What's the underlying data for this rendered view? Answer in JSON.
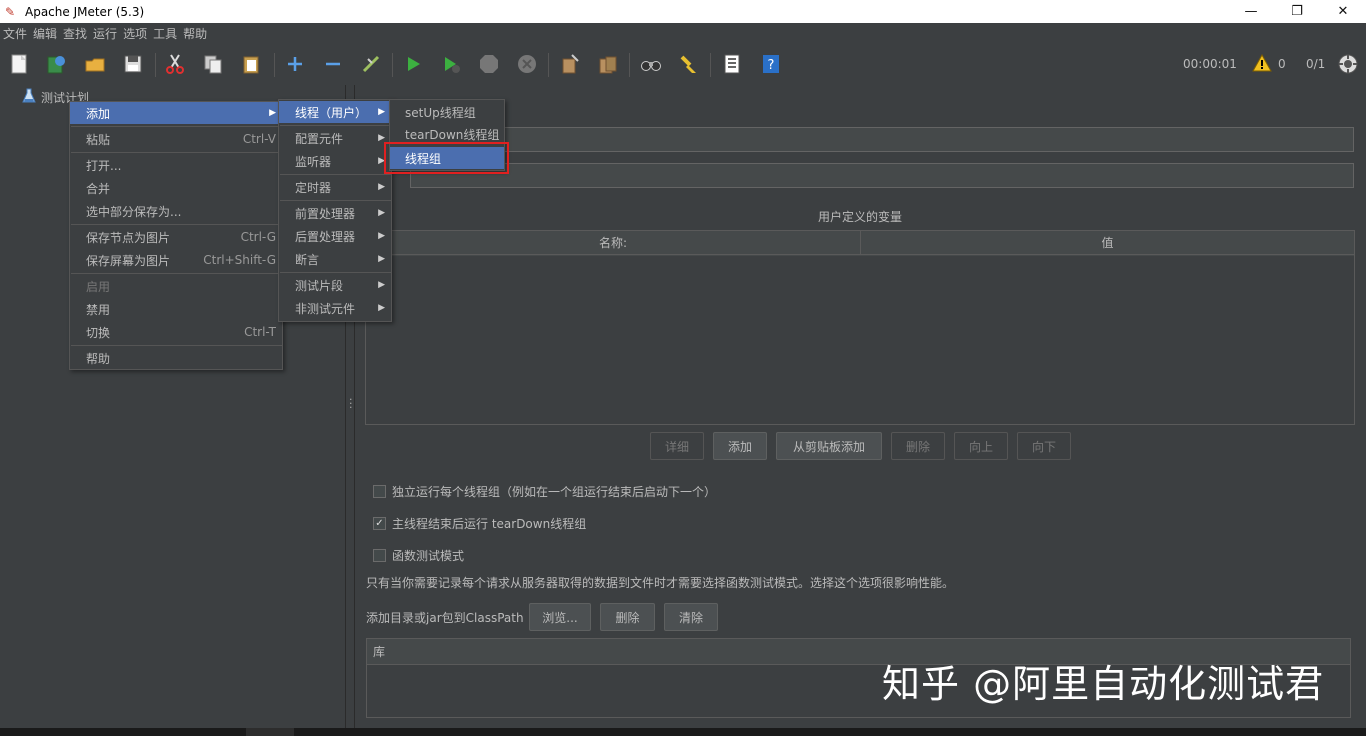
{
  "window": {
    "title": "Apache JMeter (5.3)",
    "controls": {
      "minimize": "—",
      "restore": "❐",
      "close": "✕"
    }
  },
  "menubar": [
    "文件",
    "编辑",
    "查找",
    "运行",
    "选项",
    "工具",
    "帮助"
  ],
  "toolbar": {
    "buttons": [
      "new-icon",
      "templates-icon",
      "open-icon",
      "save-icon",
      "cut-icon",
      "copy-icon",
      "paste-icon",
      "expand-icon",
      "collapse-icon",
      "toggle-icon",
      "start-icon",
      "start-no-pause-icon",
      "stop-icon",
      "shutdown-icon",
      "clear-icon",
      "clear-all-icon",
      "search-icon",
      "reset-search-icon",
      "function-helper-icon",
      "help-icon"
    ],
    "timer": "00:00:01",
    "warnings": "0",
    "threads": "0/1"
  },
  "tree": {
    "root": "测试计划"
  },
  "right_pane": {
    "vars_title": "用户定义的变量",
    "vars_columns": [
      "名称:",
      "值"
    ],
    "vars_buttons": {
      "detail": "详细",
      "add": "添加",
      "add_clipboard": "从剪贴板添加",
      "delete": "删除",
      "up": "向上",
      "down": "向下"
    },
    "checkboxes": [
      {
        "label": "独立运行每个线程组（例如在一个组运行结束后启动下一个）",
        "checked": false
      },
      {
        "label": "主线程结束后运行 tearDown线程组",
        "checked": true
      },
      {
        "label": "函数测试模式",
        "checked": false
      }
    ],
    "func_note": "只有当你需要记录每个请求从服务器取得的数据到文件时才需要选择函数测试模式。选择这个选项很影响性能。",
    "classpath_label": "添加目录或jar包到ClassPath",
    "classpath_buttons": {
      "browse": "浏览...",
      "delete": "删除",
      "clear": "清除"
    },
    "lib_header": "库"
  },
  "context_menu": {
    "items": [
      {
        "label": "添加",
        "submenu": true,
        "selected": true
      },
      {
        "label": "粘贴",
        "accel": "Ctrl-V"
      },
      {
        "label": "打开..."
      },
      {
        "label": "合并"
      },
      {
        "label": "选中部分保存为..."
      },
      {
        "label": "保存节点为图片",
        "accel": "Ctrl-G"
      },
      {
        "label": "保存屏幕为图片",
        "accel": "Ctrl+Shift-G"
      },
      {
        "label": "启用",
        "disabled": true
      },
      {
        "label": "禁用"
      },
      {
        "label": "切换",
        "accel": "Ctrl-T"
      },
      {
        "label": "帮助"
      }
    ]
  },
  "add_submenu": {
    "items": [
      {
        "label": "线程（用户）",
        "selected": true
      },
      {
        "label": "配置元件"
      },
      {
        "label": "监听器"
      },
      {
        "label": "定时器"
      },
      {
        "label": "前置处理器"
      },
      {
        "label": "后置处理器"
      },
      {
        "label": "断言"
      },
      {
        "label": "测试片段"
      },
      {
        "label": "非测试元件"
      }
    ]
  },
  "thread_submenu": {
    "items": [
      {
        "label": "setUp线程组"
      },
      {
        "label": "tearDown线程组"
      },
      {
        "label": "线程组",
        "selected": true
      }
    ]
  },
  "watermark": "知乎 @阿里自动化测试君",
  "colors": {
    "accent": "#4b6eaf",
    "highlight": "#e02020",
    "background": "#3c3f41"
  }
}
